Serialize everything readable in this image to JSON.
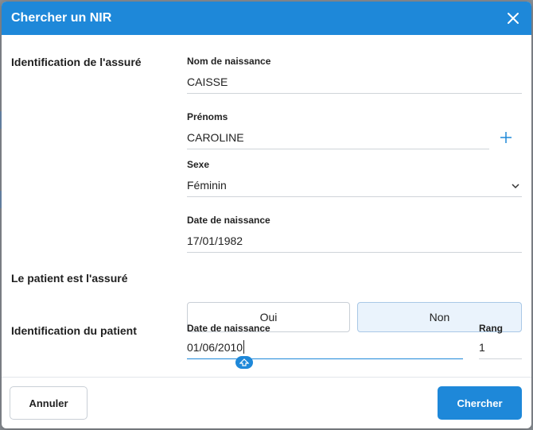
{
  "dialog": {
    "title": "Chercher un NIR"
  },
  "sections": {
    "assure": "Identification de l'assuré",
    "patient_is_assure": "Le patient est l'assuré",
    "patient": "Identification du patient"
  },
  "fields": {
    "nom_naissance": {
      "label": "Nom de naissance",
      "value": "CAISSE"
    },
    "prenoms": {
      "label": "Prénoms",
      "value": "CAROLINE"
    },
    "sexe": {
      "label": "Sexe",
      "value": "Féminin"
    },
    "date_naissance_assure": {
      "label": "Date de naissance",
      "value": "17/01/1982"
    },
    "date_naissance_patient": {
      "label": "Date de naissance",
      "value": "01/06/2010"
    },
    "rang": {
      "label": "Rang",
      "value": "1"
    }
  },
  "toggle": {
    "oui": "Oui",
    "non": "Non",
    "selected": "non"
  },
  "footer": {
    "cancel_label": "Annuler",
    "search_label": "Chercher"
  },
  "colors": {
    "accent": "#1e88d9",
    "selected_bg": "#eaf3fc"
  },
  "icons": [
    "close-icon",
    "plus-icon",
    "chevron-down-icon",
    "text-handle-icon"
  ]
}
